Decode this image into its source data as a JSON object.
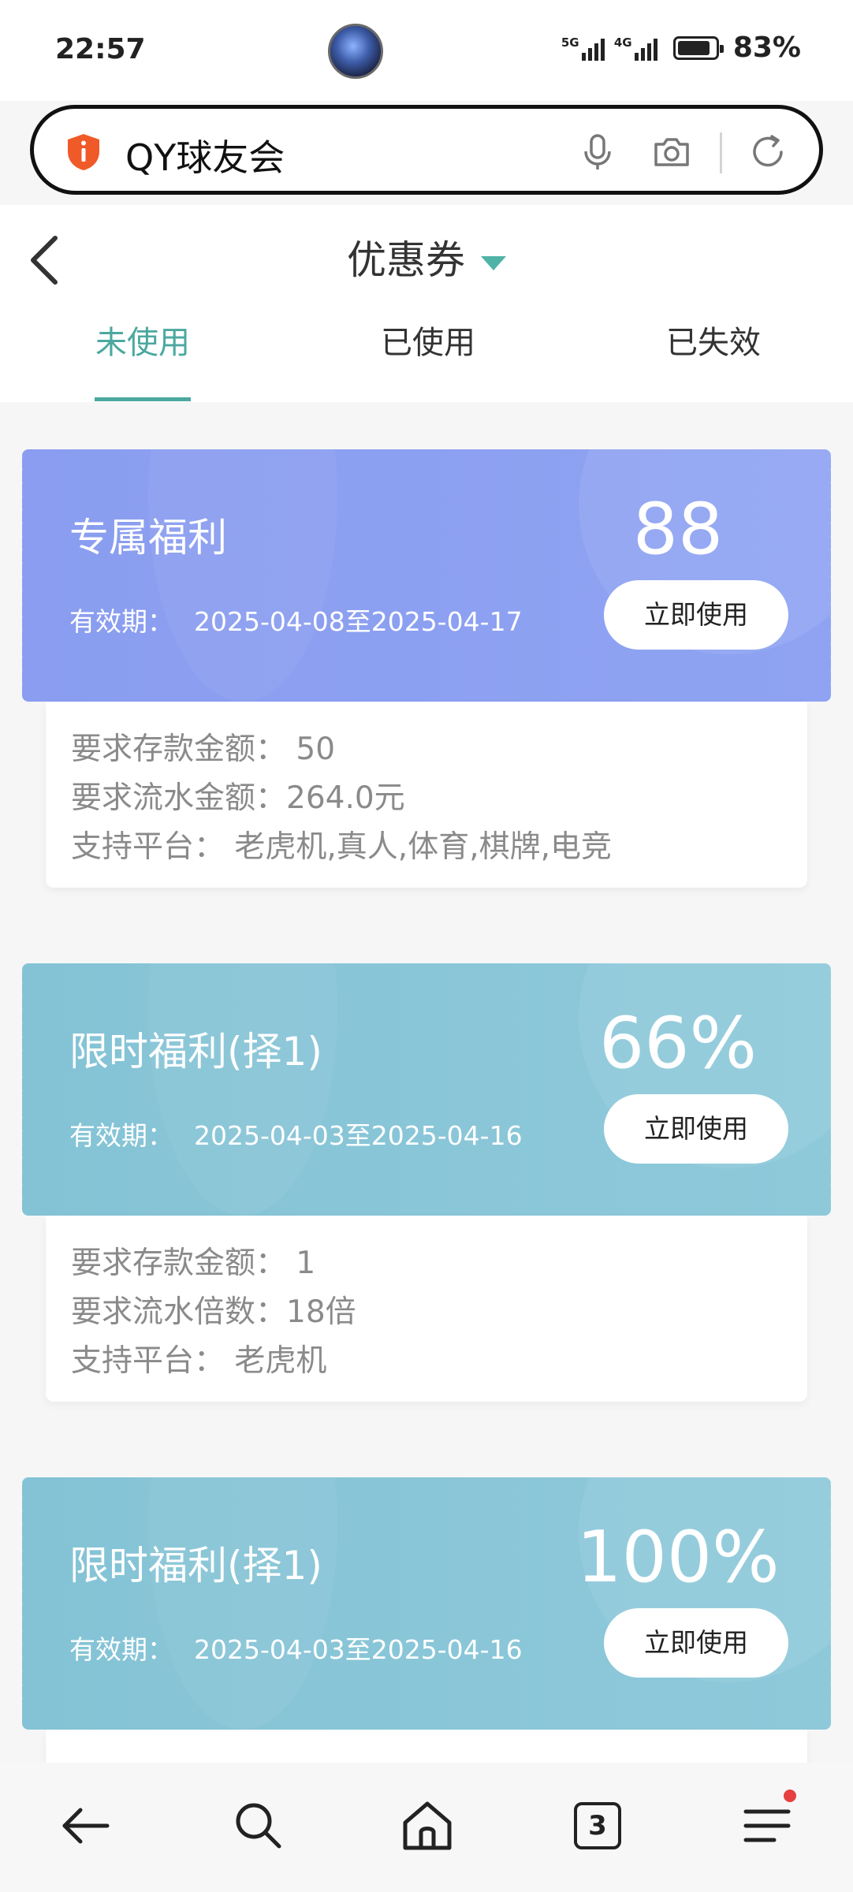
{
  "status": {
    "time": "22:57",
    "signal1": "5G",
    "signal2": "4G",
    "battery": "83%",
    "battery_level": 0.83
  },
  "browser": {
    "url_text": "QY球友会"
  },
  "header": {
    "title": "优惠券",
    "tabs": [
      "未使用",
      "已使用",
      "已失效"
    ],
    "active_tab": 0
  },
  "coupons": [
    {
      "title": "专属福利",
      "validity_label": "有效期：",
      "validity": "2025-04-08至2025-04-17",
      "amount": "88",
      "button": "立即使用",
      "color": "#8a9df0",
      "details": [
        "要求存款金额： 50",
        "要求流水金额：264.0元",
        "支持平台： 老虎机,真人,体育,棋牌,电竞"
      ]
    },
    {
      "title": "限时福利(择1)",
      "validity_label": "有效期：",
      "validity": "2025-04-03至2025-04-16",
      "amount": "66%",
      "button": "立即使用",
      "color": "#84c3d5",
      "details": [
        "要求存款金额： 1",
        "要求流水倍数：18倍",
        "支持平台： 老虎机"
      ]
    },
    {
      "title": "限时福利(择1)",
      "validity_label": "有效期：",
      "validity": "2025-04-03至2025-04-16",
      "amount": "100%",
      "button": "立即使用",
      "color": "#84c3d5",
      "details": []
    }
  ],
  "bottom_nav": {
    "tab_count": "3",
    "items": [
      "back-icon",
      "search-icon",
      "home-icon",
      "tabs-icon",
      "menu-icon"
    ]
  }
}
